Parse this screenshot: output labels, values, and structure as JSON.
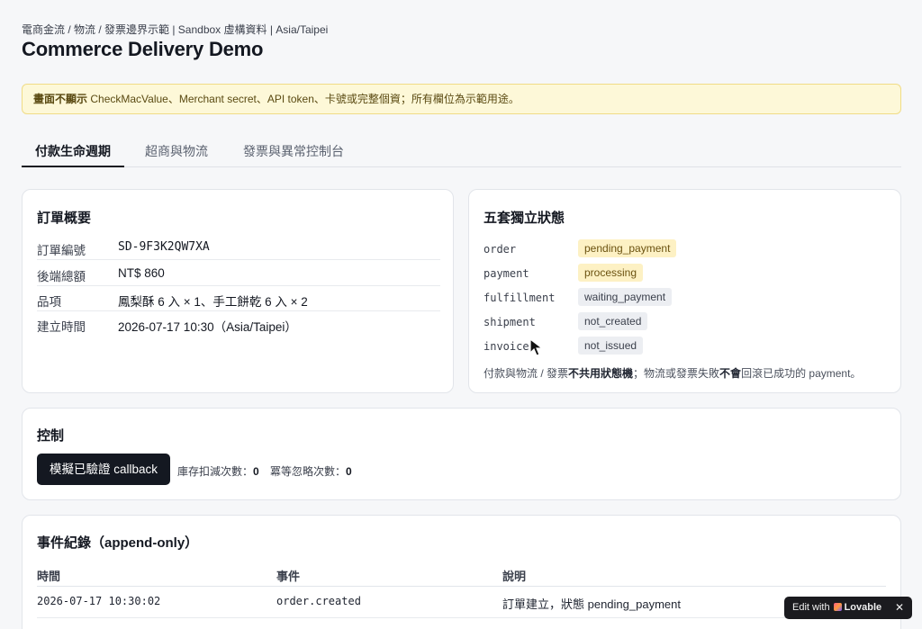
{
  "header": {
    "breadcrumb": "電商金流 / 物流 / 發票邊界示範 | Sandbox 虛構資料 | Asia/Taipei",
    "title": "Commerce Delivery Demo"
  },
  "notice": {
    "prefix_bold": "畫面不顯示",
    "text": " CheckMacValue、Merchant secret、API token、卡號或完整個資；所有欄位為示範用途。"
  },
  "tabs": [
    {
      "label": "付款生命週期",
      "active": true
    },
    {
      "label": "超商與物流",
      "active": false
    },
    {
      "label": "發票與異常控制台",
      "active": false
    }
  ],
  "order_summary": {
    "title": "訂單概要",
    "rows": [
      {
        "key": "訂單編號",
        "value": "SD-9F3K2QW7XA"
      },
      {
        "key": "後端總額",
        "value": "NT$ 860"
      },
      {
        "key": "品項",
        "value": "鳳梨酥 6 入 × 1、手工餅乾 6 入 × 2"
      },
      {
        "key": "建立時間",
        "value": "2026-07-17 10:30（Asia/Taipei）"
      }
    ]
  },
  "states": {
    "title": "五套獨立狀態",
    "items": [
      {
        "key": "order",
        "value": "pending_payment",
        "tone": "yellow"
      },
      {
        "key": "payment",
        "value": "processing",
        "tone": "yellow"
      },
      {
        "key": "fulfillment",
        "value": "waiting_payment",
        "tone": "gray"
      },
      {
        "key": "shipment",
        "value": "not_created",
        "tone": "gray"
      },
      {
        "key": "invoice",
        "value": "not_issued",
        "tone": "gray"
      }
    ],
    "note_1": "付款與物流 / 發票",
    "note_bold_1": "不共用狀態機",
    "note_2": "；物流或發票失敗",
    "note_bold_2": "不會",
    "note_3": "回滾已成功的 payment。"
  },
  "controls": {
    "title": "控制",
    "button_label": "模擬已驗證 callback",
    "stock_label": "庫存扣減次數：",
    "stock_value": "0",
    "idempotent_label": "冪等忽略次數：",
    "idempotent_value": "0"
  },
  "events": {
    "title": "事件紀錄（append-only）",
    "columns": [
      "時間",
      "事件",
      "說明"
    ],
    "rows": [
      {
        "time": "2026-07-17 10:30:02",
        "event": "order.created",
        "desc": "訂單建立，狀態 pending_payment"
      }
    ]
  },
  "badge": {
    "edit_with": "Edit with",
    "brand": "Lovable",
    "close": "✕"
  },
  "colors": {
    "primary": "#141821",
    "notice_bg": "#fdf8d8",
    "badge_yellow": "#fdf1c4",
    "badge_gray": "#eceef2"
  }
}
